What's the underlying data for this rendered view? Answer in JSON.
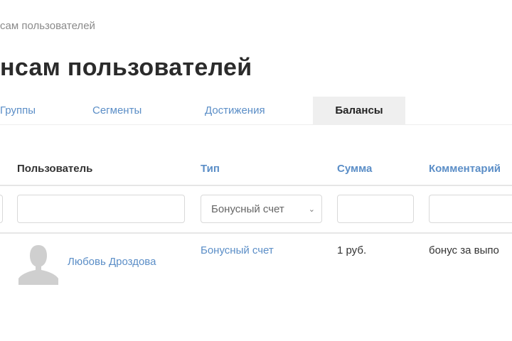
{
  "breadcrumb": "сам пользователей",
  "title": "нсам пользователей",
  "tabs": [
    {
      "label": "Группы",
      "active": false
    },
    {
      "label": "Сегменты",
      "active": false
    },
    {
      "label": "Достижения",
      "active": false
    },
    {
      "label": "Балансы",
      "active": true
    }
  ],
  "table": {
    "headers": {
      "user": "Пользователь",
      "type": "Тип",
      "sum": "Сумма",
      "comment": "Комментарий"
    },
    "filters": {
      "user": "",
      "type": "Бонусный счет",
      "sum": "",
      "comment": ""
    },
    "rows": [
      {
        "user": "Любовь Дроздова",
        "type": "Бонусный счет",
        "sum": "1 руб.",
        "comment": "бонус за выпо"
      }
    ]
  },
  "colors": {
    "link": "#5b8ec7",
    "active_tab_bg": "#efefef"
  }
}
